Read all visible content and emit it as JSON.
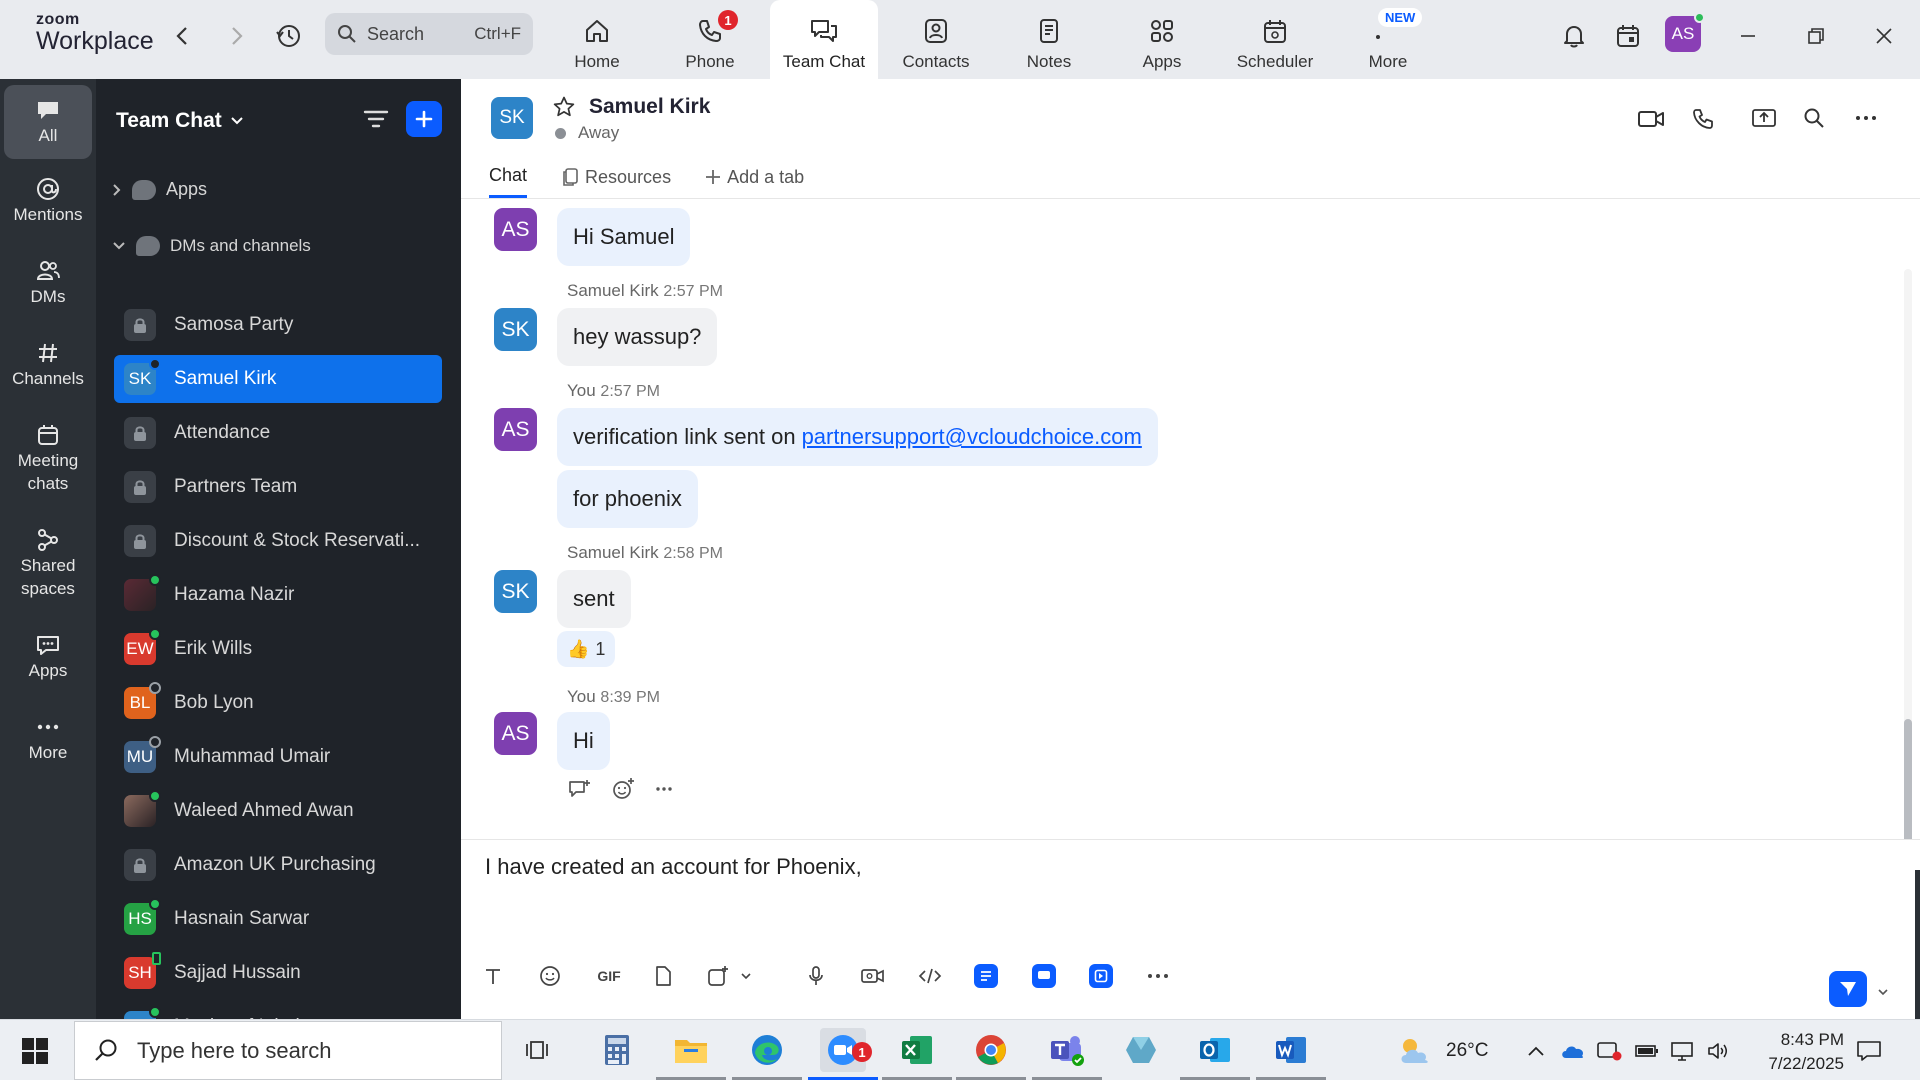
{
  "app": {
    "logo_line1": "zoom",
    "logo_line2": "Workplace"
  },
  "topbar": {
    "search_placeholder": "Search",
    "search_shortcut": "Ctrl+F",
    "tabs": [
      {
        "label": "Home",
        "icon": "home-icon"
      },
      {
        "label": "Phone",
        "icon": "phone-icon",
        "badge": "1"
      },
      {
        "label": "Team Chat",
        "icon": "chat-icon",
        "active": true
      },
      {
        "label": "Contacts",
        "icon": "contacts-icon"
      },
      {
        "label": "Notes",
        "icon": "notes-icon"
      },
      {
        "label": "Apps",
        "icon": "apps-icon"
      },
      {
        "label": "Scheduler",
        "icon": "scheduler-icon"
      },
      {
        "label": "More",
        "icon": "more-icon",
        "tag": "NEW"
      }
    ],
    "user_initials": "AS"
  },
  "rail": {
    "items": [
      {
        "label": "All",
        "icon": "chat-bubble-icon",
        "active": true
      },
      {
        "label": "Mentions",
        "icon": "at-icon"
      },
      {
        "label": "DMs",
        "icon": "people-icon"
      },
      {
        "label": "Channels",
        "icon": "hash-icon"
      },
      {
        "label": "Meeting\nchats",
        "icon": "calendar-icon"
      },
      {
        "label": "Shared\nspaces",
        "icon": "share-icon"
      },
      {
        "label": "Apps",
        "icon": "apps-bubble-icon"
      },
      {
        "label": "More",
        "icon": "ellipsis-icon"
      }
    ]
  },
  "sidebar": {
    "title": "Team Chat",
    "sections": {
      "apps": "Apps",
      "dms": "DMs and channels"
    },
    "channels": [
      {
        "name": "Samosa Party",
        "type": "lock"
      },
      {
        "name": "Samuel Kirk",
        "type": "avatar",
        "initials": "SK",
        "color": "#2d84c8",
        "status": "away",
        "active": true
      },
      {
        "name": "Attendance",
        "type": "lock"
      },
      {
        "name": "Partners Team",
        "type": "lock"
      },
      {
        "name": "Discount & Stock Reservati...",
        "type": "lock"
      },
      {
        "name": "Hazama Nazir",
        "type": "photo",
        "color": "#5a2a35",
        "status": "online"
      },
      {
        "name": "Erik Wills",
        "type": "avatar",
        "initials": "EW",
        "color": "#d93a2e",
        "status": "online"
      },
      {
        "name": "Bob Lyon",
        "type": "avatar",
        "initials": "BL",
        "color": "#e0631d",
        "status": "away"
      },
      {
        "name": "Muhammad Umair",
        "type": "avatar",
        "initials": "MU",
        "color": "#3e5f84",
        "status": "away"
      },
      {
        "name": "Waleed Ahmed Awan",
        "type": "photo",
        "color": "#8b6a5e",
        "status": "online"
      },
      {
        "name": "Amazon UK Purchasing",
        "type": "lock"
      },
      {
        "name": "Hasnain Sarwar",
        "type": "avatar",
        "initials": "HS",
        "color": "#25a244",
        "status": "online"
      },
      {
        "name": "Sajjad Hussain",
        "type": "avatar",
        "initials": "SH",
        "color": "#d93a2e",
        "status": "mobile"
      },
      {
        "name": "Musharaf Iqbal",
        "type": "avatar",
        "initials": "MI",
        "color": "#2d84c8",
        "status": "online"
      }
    ]
  },
  "chat": {
    "contact_initials": "SK",
    "contact_name": "Samuel Kirk",
    "contact_status": "Away",
    "tabs": {
      "chat": "Chat",
      "resources": "Resources",
      "add": "Add a tab"
    },
    "messages": {
      "m1_text": "Hi Samuel",
      "m1_initials": "AS",
      "m2_sender": "Samuel Kirk",
      "m2_time": "2:57 PM",
      "m2_text": "hey wassup?",
      "m2_initials": "SK",
      "m3_sender": "You",
      "m3_time": "2:57 PM",
      "m3_text": "verification link sent on",
      "m3_link": "partnersupport@vcloudchoice.com",
      "m3_initials": "AS",
      "m4_text": "for phoenix",
      "m5_sender": "Samuel Kirk",
      "m5_time": "2:58 PM",
      "m5_text": "sent",
      "m5_initials": "SK",
      "m5_reaction_emoji": "👍",
      "m5_reaction_count": "1",
      "m6_sender": "You",
      "m6_time": "8:39 PM",
      "m6_text": "Hi",
      "m6_initials": "AS"
    },
    "composer_text": "I have created an account for Phoenix,"
  },
  "taskbar": {
    "search_placeholder": "Type here to search",
    "weather_temp": "26°C",
    "time": "8:43 PM",
    "date": "7/22/2025",
    "zoom_badge": "1"
  }
}
